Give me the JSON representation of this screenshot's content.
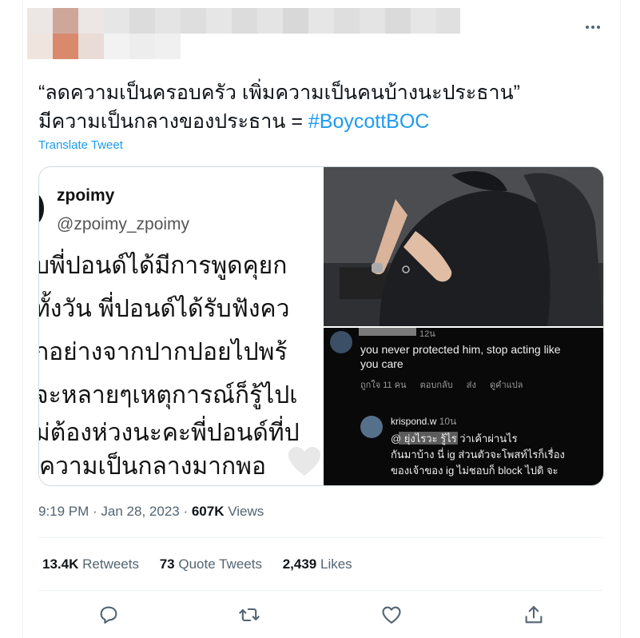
{
  "tweet": {
    "text_line1": "“ลดความเป็นครอบครัว เพิ่มความเป็นคนบ้างนะประธาน”",
    "text_line2_prefix": "มีความเป็นกลางของประธาน = ",
    "hashtag": "#BoycottBOC",
    "translate_label": "Translate Tweet",
    "time": "9:19 PM",
    "date": "Jan 28, 2023",
    "views_count": "607K",
    "views_label": "Views"
  },
  "stats": {
    "retweets_count": "13.4K",
    "retweets_label": "Retweets",
    "quotes_count": "73",
    "quotes_label": "Quote Tweets",
    "likes_count": "2,439",
    "likes_label": "Likes"
  },
  "media": {
    "left": {
      "name": "zpoimy",
      "handle": "@zpoimy_zpoimy",
      "lines": [
        "ับพี่ปอนด์ได้มีการพูดคุยก",
        "ทั้งวัน พี่ปอนด์ได้รับฟังคว",
        "กอย่างจากปากปอยไปพร้",
        "จะหลายๆเหตุการณ์ก็รู้ไปเ",
        "ม่ต้องห่วงนะคะพี่ปอนด์ที่ป",
        "ความเป็นกลางมากพอ"
      ]
    },
    "comments": {
      "c1_time": "12น",
      "c1_text_1": "you never protected him, stop acting like",
      "c1_text_2": "you care",
      "c1_actions": [
        "ถูกใจ 11 คน",
        "ตอบกลับ",
        "ส่ง",
        "ดูคำแปล"
      ],
      "c2_user": "krispond.w",
      "c2_time": "10น",
      "c2_text_1": "@                  ยุ่งไรวะ รู้ไร ว่าเค้าผ่านไร",
      "c2_text_2": "กันมาบ้าง นี่ ig ส่วนตัวจะโพสท์ไรก็เรื่อง",
      "c2_text_3": "ของเจ้าของ ig ไม่ชอบก็ block ไปดิ จะ"
    }
  },
  "icons": {
    "more": "more-dots-icon",
    "reply": "reply-icon",
    "retweet": "retweet-icon",
    "like": "heart-icon",
    "share": "share-icon"
  },
  "colors": {
    "accent": "#1d9bf0",
    "text": "#0f1419",
    "secondary": "#536471",
    "border": "#cfd9de"
  }
}
